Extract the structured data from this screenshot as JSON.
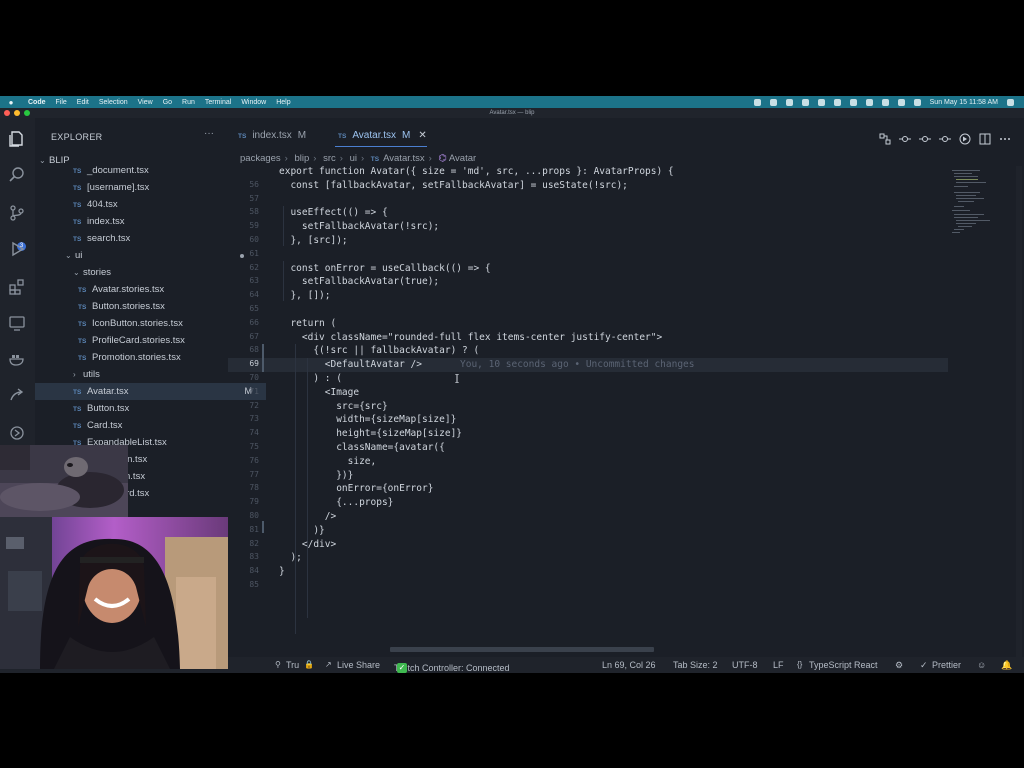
{
  "menubar": {
    "app": "Code",
    "items": [
      "File",
      "Edit",
      "Selection",
      "View",
      "Go",
      "Run",
      "Terminal",
      "Window",
      "Help"
    ],
    "datetime": "Sun May 15  11:58 AM"
  },
  "window": {
    "title": "Avatar.tsx — blip"
  },
  "explorer": {
    "title": "EXPLORER",
    "more": "···",
    "root": "BLIP",
    "files": [
      {
        "name": "_document.tsx",
        "icon": "TS"
      },
      {
        "name": "[username].tsx",
        "icon": "TS"
      },
      {
        "name": "404.tsx",
        "icon": "TS"
      },
      {
        "name": "index.tsx",
        "icon": "TS"
      },
      {
        "name": "search.tsx",
        "icon": "TS"
      }
    ],
    "folder_ui": "ui",
    "folder_stories": "stories",
    "stories": [
      {
        "name": "Avatar.stories.tsx",
        "icon": "TS"
      },
      {
        "name": "Button.stories.tsx",
        "icon": "TS"
      },
      {
        "name": "IconButton.stories.tsx",
        "icon": "TS"
      },
      {
        "name": "ProfileCard.stories.tsx",
        "icon": "TS"
      },
      {
        "name": "Promotion.stories.tsx",
        "icon": "TS"
      }
    ],
    "folder_utils": "utils",
    "ui_files": [
      {
        "name": "Avatar.tsx",
        "icon": "TS",
        "status": "M"
      },
      {
        "name": "Button.tsx",
        "icon": "TS"
      },
      {
        "name": "Card.tsx",
        "icon": "TS"
      },
      {
        "name": "ExpandableList.tsx",
        "icon": "TS"
      },
      {
        "name": "IconButton.tsx",
        "icon": "TS"
      },
      {
        "name": "Promotion.tsx",
        "icon": "TS"
      },
      {
        "name": "ProfileCard.tsx",
        "icon": "TS"
      }
    ]
  },
  "tabs": [
    {
      "icon": "TS",
      "label": "index.tsx",
      "status": "M"
    },
    {
      "icon": "TS",
      "label": "Avatar.tsx",
      "status": "M",
      "close": "✕"
    }
  ],
  "breadcrumb": [
    "packages",
    "blip",
    "src",
    "ui",
    "Avatar.tsx",
    "Avatar"
  ],
  "editor": {
    "current_line": "69",
    "blame": "You, 10 seconds ago • Uncommitted changes",
    "lines": [
      {
        "n": "",
        "t": "export function Avatar({ size = 'md', src, ...props }: AvatarProps) {"
      },
      {
        "n": "56",
        "t": "  const [fallbackAvatar, setFallbackAvatar] = useState(!src);"
      },
      {
        "n": "57",
        "t": ""
      },
      {
        "n": "58",
        "t": "  useEffect(() => {"
      },
      {
        "n": "59",
        "t": "    setFallbackAvatar(!src);"
      },
      {
        "n": "60",
        "t": "  }, [src]);"
      },
      {
        "n": "61",
        "t": ""
      },
      {
        "n": "62",
        "t": "  const onError = useCallback(() => {"
      },
      {
        "n": "63",
        "t": "    setFallbackAvatar(true);"
      },
      {
        "n": "64",
        "t": "  }, []);"
      },
      {
        "n": "65",
        "t": ""
      },
      {
        "n": "66",
        "t": "  return ("
      },
      {
        "n": "67",
        "t": "    <div className=\"rounded-full flex items-center justify-center\">"
      },
      {
        "n": "68",
        "t": "      {(!src || fallbackAvatar) ? ("
      },
      {
        "n": "69",
        "t": "        <DefaultAvatar />"
      },
      {
        "n": "70",
        "t": "      ) : ("
      },
      {
        "n": "71",
        "t": "        <Image"
      },
      {
        "n": "72",
        "t": "          src={src}"
      },
      {
        "n": "73",
        "t": "          width={sizeMap[size]}"
      },
      {
        "n": "74",
        "t": "          height={sizeMap[size]}"
      },
      {
        "n": "75",
        "t": "          className={avatar({"
      },
      {
        "n": "76",
        "t": "            size,"
      },
      {
        "n": "77",
        "t": "          })}"
      },
      {
        "n": "78",
        "t": "          onError={onError}"
      },
      {
        "n": "79",
        "t": "          {...props}"
      },
      {
        "n": "80",
        "t": "        />"
      },
      {
        "n": "81",
        "t": "      )}"
      },
      {
        "n": "82",
        "t": "    </div>"
      },
      {
        "n": "83",
        "t": "  );"
      },
      {
        "n": "84",
        "t": "}"
      },
      {
        "n": "85",
        "t": ""
      }
    ]
  },
  "status": {
    "problems": "0 ⚠ 0",
    "user": "Tru",
    "live_share": "Live Share",
    "twitch": "Twitch Controller: Connected",
    "position": "Ln 69, Col 26",
    "tab_size": "Tab Size: 2",
    "encoding": "UTF-8",
    "eol": "LF",
    "language": "TypeScript React",
    "formatter": "Prettier"
  },
  "colors": {
    "accent": "#1c7389",
    "tab_accent": "#4b7fd1",
    "check": "#3fb950"
  }
}
